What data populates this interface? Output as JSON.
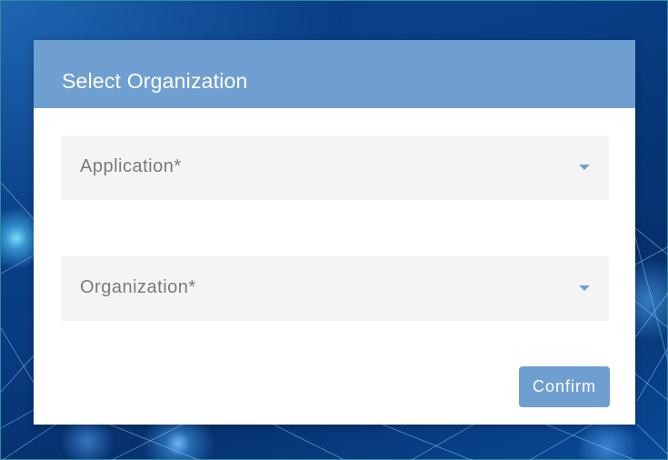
{
  "dialog": {
    "title": "Select Organization",
    "fields": [
      {
        "label": "Application*",
        "icon": "chevron-down-icon"
      },
      {
        "label": "Organization*",
        "icon": "chevron-down-icon"
      }
    ],
    "confirm_label": "Confirm"
  },
  "colors": {
    "accent": "#6f9fd0",
    "field_background": "#f4f4f4",
    "label_text": "#7a7a7a"
  }
}
